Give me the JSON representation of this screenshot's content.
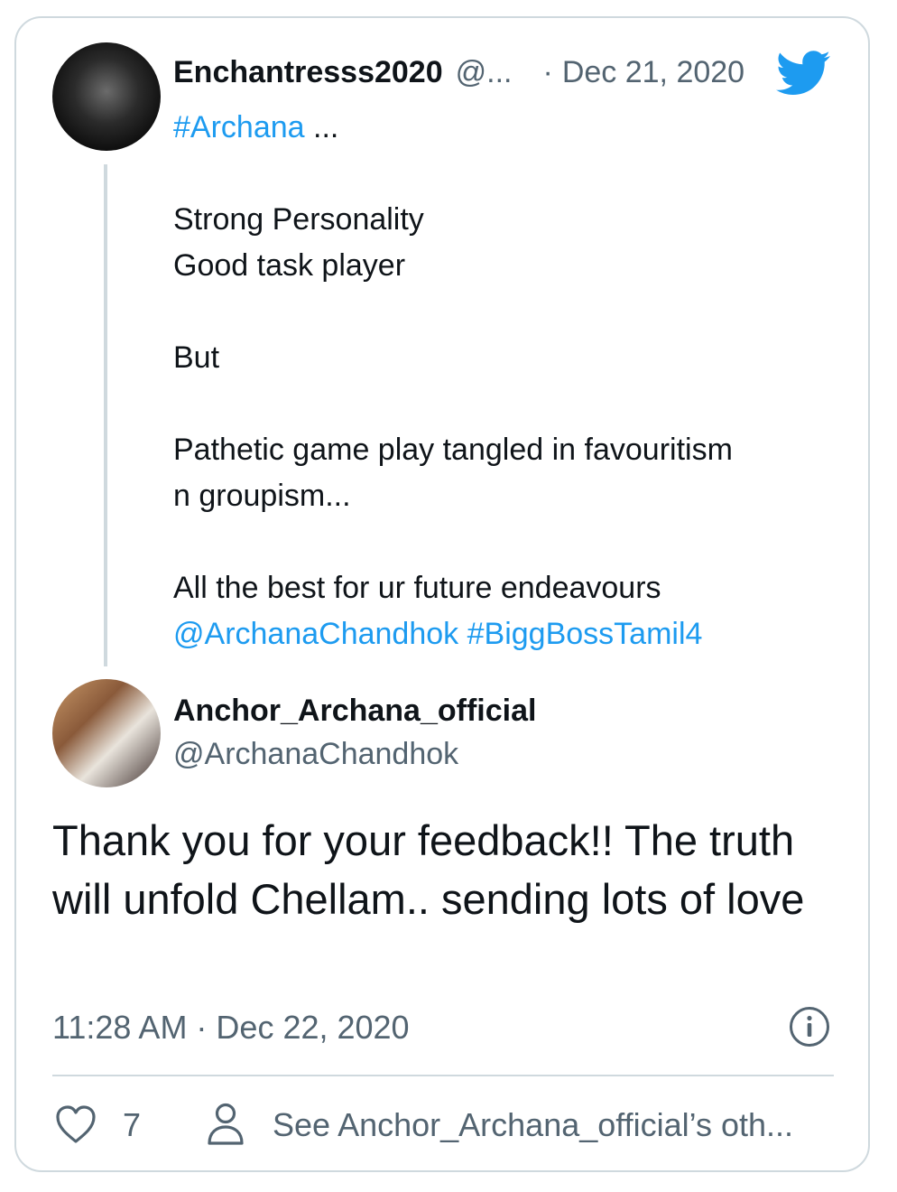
{
  "quoted_tweet": {
    "author_name": "Enchantresss2020",
    "author_handle_truncated": "@...",
    "separator": "·",
    "date": "Dec 21, 2020",
    "hashtag_line": "#Archana",
    "hashtag_suffix": " ...",
    "lines": [
      "Strong Personality",
      "Good task player",
      "But",
      "Pathetic game play tangled in favouritism",
      "n groupism...",
      "All the best for ur future endeavours"
    ],
    "mention": "@ArchanaChandhok",
    "hashtag_end": "#BiggBossTamil4"
  },
  "reply_tweet": {
    "author_name": "Anchor_Archana_official",
    "author_handle": "@ArchanaChandhok",
    "text": "Thank you for your feedback!! The truth will unfold Chellam.. sending lots of love",
    "time": "11:28 AM · Dec 22, 2020",
    "likes_count": "7",
    "see_other_label": "See Anchor_Archana_official’s oth..."
  },
  "icons": {
    "brand": "twitter-bird-icon",
    "info": "info-icon",
    "like": "heart-icon",
    "profile": "person-icon"
  },
  "colors": {
    "link": "#1d9bf0",
    "secondary_text": "#536471",
    "border": "#cfd9de"
  }
}
